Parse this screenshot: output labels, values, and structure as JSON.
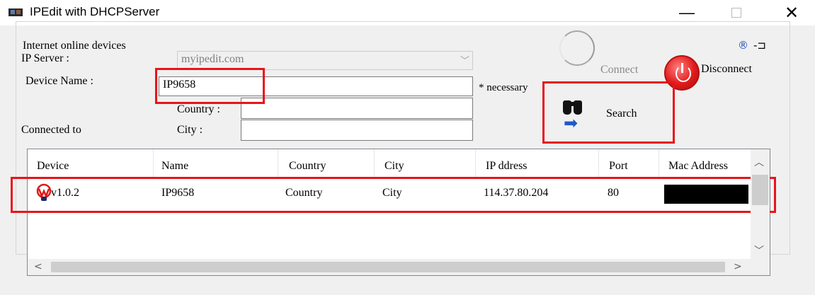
{
  "window": {
    "title": "IPEdit with DHCPServer",
    "minimize": "—",
    "close": "✕"
  },
  "group": {
    "legend": "Internet online devices"
  },
  "form": {
    "ip_server_label": "IP Server :",
    "ip_server_value": "myipedit.com",
    "device_name_label": "Device Name :",
    "device_name_value": "IP9658",
    "necessary_note": "* necessary",
    "country_label": "Country :",
    "country_value": "",
    "city_label": "City :",
    "city_value": "",
    "connected_to_label": "Connected to"
  },
  "buttons": {
    "connect": "Connect",
    "disconnect": "Disconnect",
    "search": "Search"
  },
  "table": {
    "headers": [
      "Device",
      "Name",
      "Country",
      "City",
      "IP ddress",
      "Port",
      "Mac Address"
    ],
    "rows": [
      [
        "v1.0.2",
        "IP9658",
        "Country",
        "City",
        "114.37.80.204",
        "80",
        ""
      ]
    ]
  },
  "icons": {
    "app": "app-icon",
    "connection_status": "signal-icon",
    "pin": "pin-icon",
    "connect": "connect-ring-icon",
    "disconnect": "power-icon",
    "search": "binoculars-icon",
    "device": "device-logo-icon"
  },
  "colors": {
    "highlight": "#e8141a",
    "disconnect": "#e11b1b",
    "accent": "#1f58c8"
  }
}
